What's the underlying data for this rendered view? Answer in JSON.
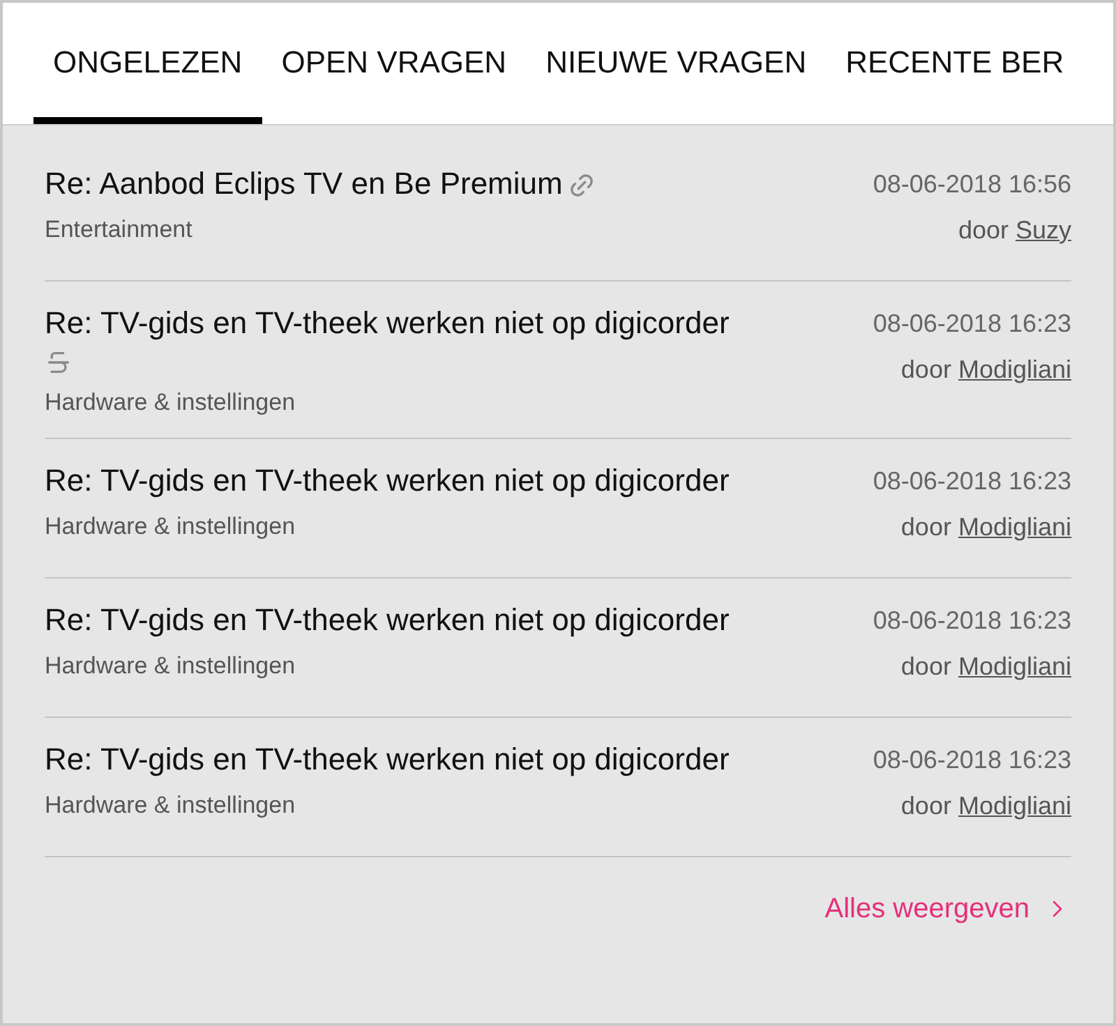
{
  "tabs": [
    {
      "label": "ONGELEZEN",
      "selected": true
    },
    {
      "label": "OPEN VRAGEN",
      "selected": false
    },
    {
      "label": "NIEUWE VRAGEN",
      "selected": false
    },
    {
      "label": "RECENTE BER",
      "selected": false
    }
  ],
  "posts": [
    {
      "title": "Re: Aanbod Eclips TV en Be Premium",
      "kind": "linked",
      "category": "Entertainment",
      "date": "08-06-2018 16:56",
      "by": "door",
      "author": "Suzy"
    },
    {
      "title": "Re: TV-gids en TV-theek werken niet op digicorder",
      "kind": "struck",
      "category": "Hardware & instellingen",
      "date": "08-06-2018 16:23",
      "by": "door",
      "author": "Modigliani"
    },
    {
      "title": "Re: TV-gids en TV-theek werken niet op digicorder",
      "category": "Hardware & instellingen",
      "date": "08-06-2018 16:23",
      "by": "door",
      "author": "Modigliani"
    },
    {
      "title": "Re: TV-gids en TV-theek werken niet op digicorder",
      "category": "Hardware & instellingen",
      "date": "08-06-2018 16:23",
      "by": "door",
      "author": "Modigliani"
    },
    {
      "title": "Re: TV-gids en TV-theek werken niet op digicorder",
      "category": "Hardware & instellingen",
      "date": "08-06-2018 16:23",
      "by": "door",
      "author": "Modigliani"
    }
  ],
  "footer_link": "Alles weergeven"
}
